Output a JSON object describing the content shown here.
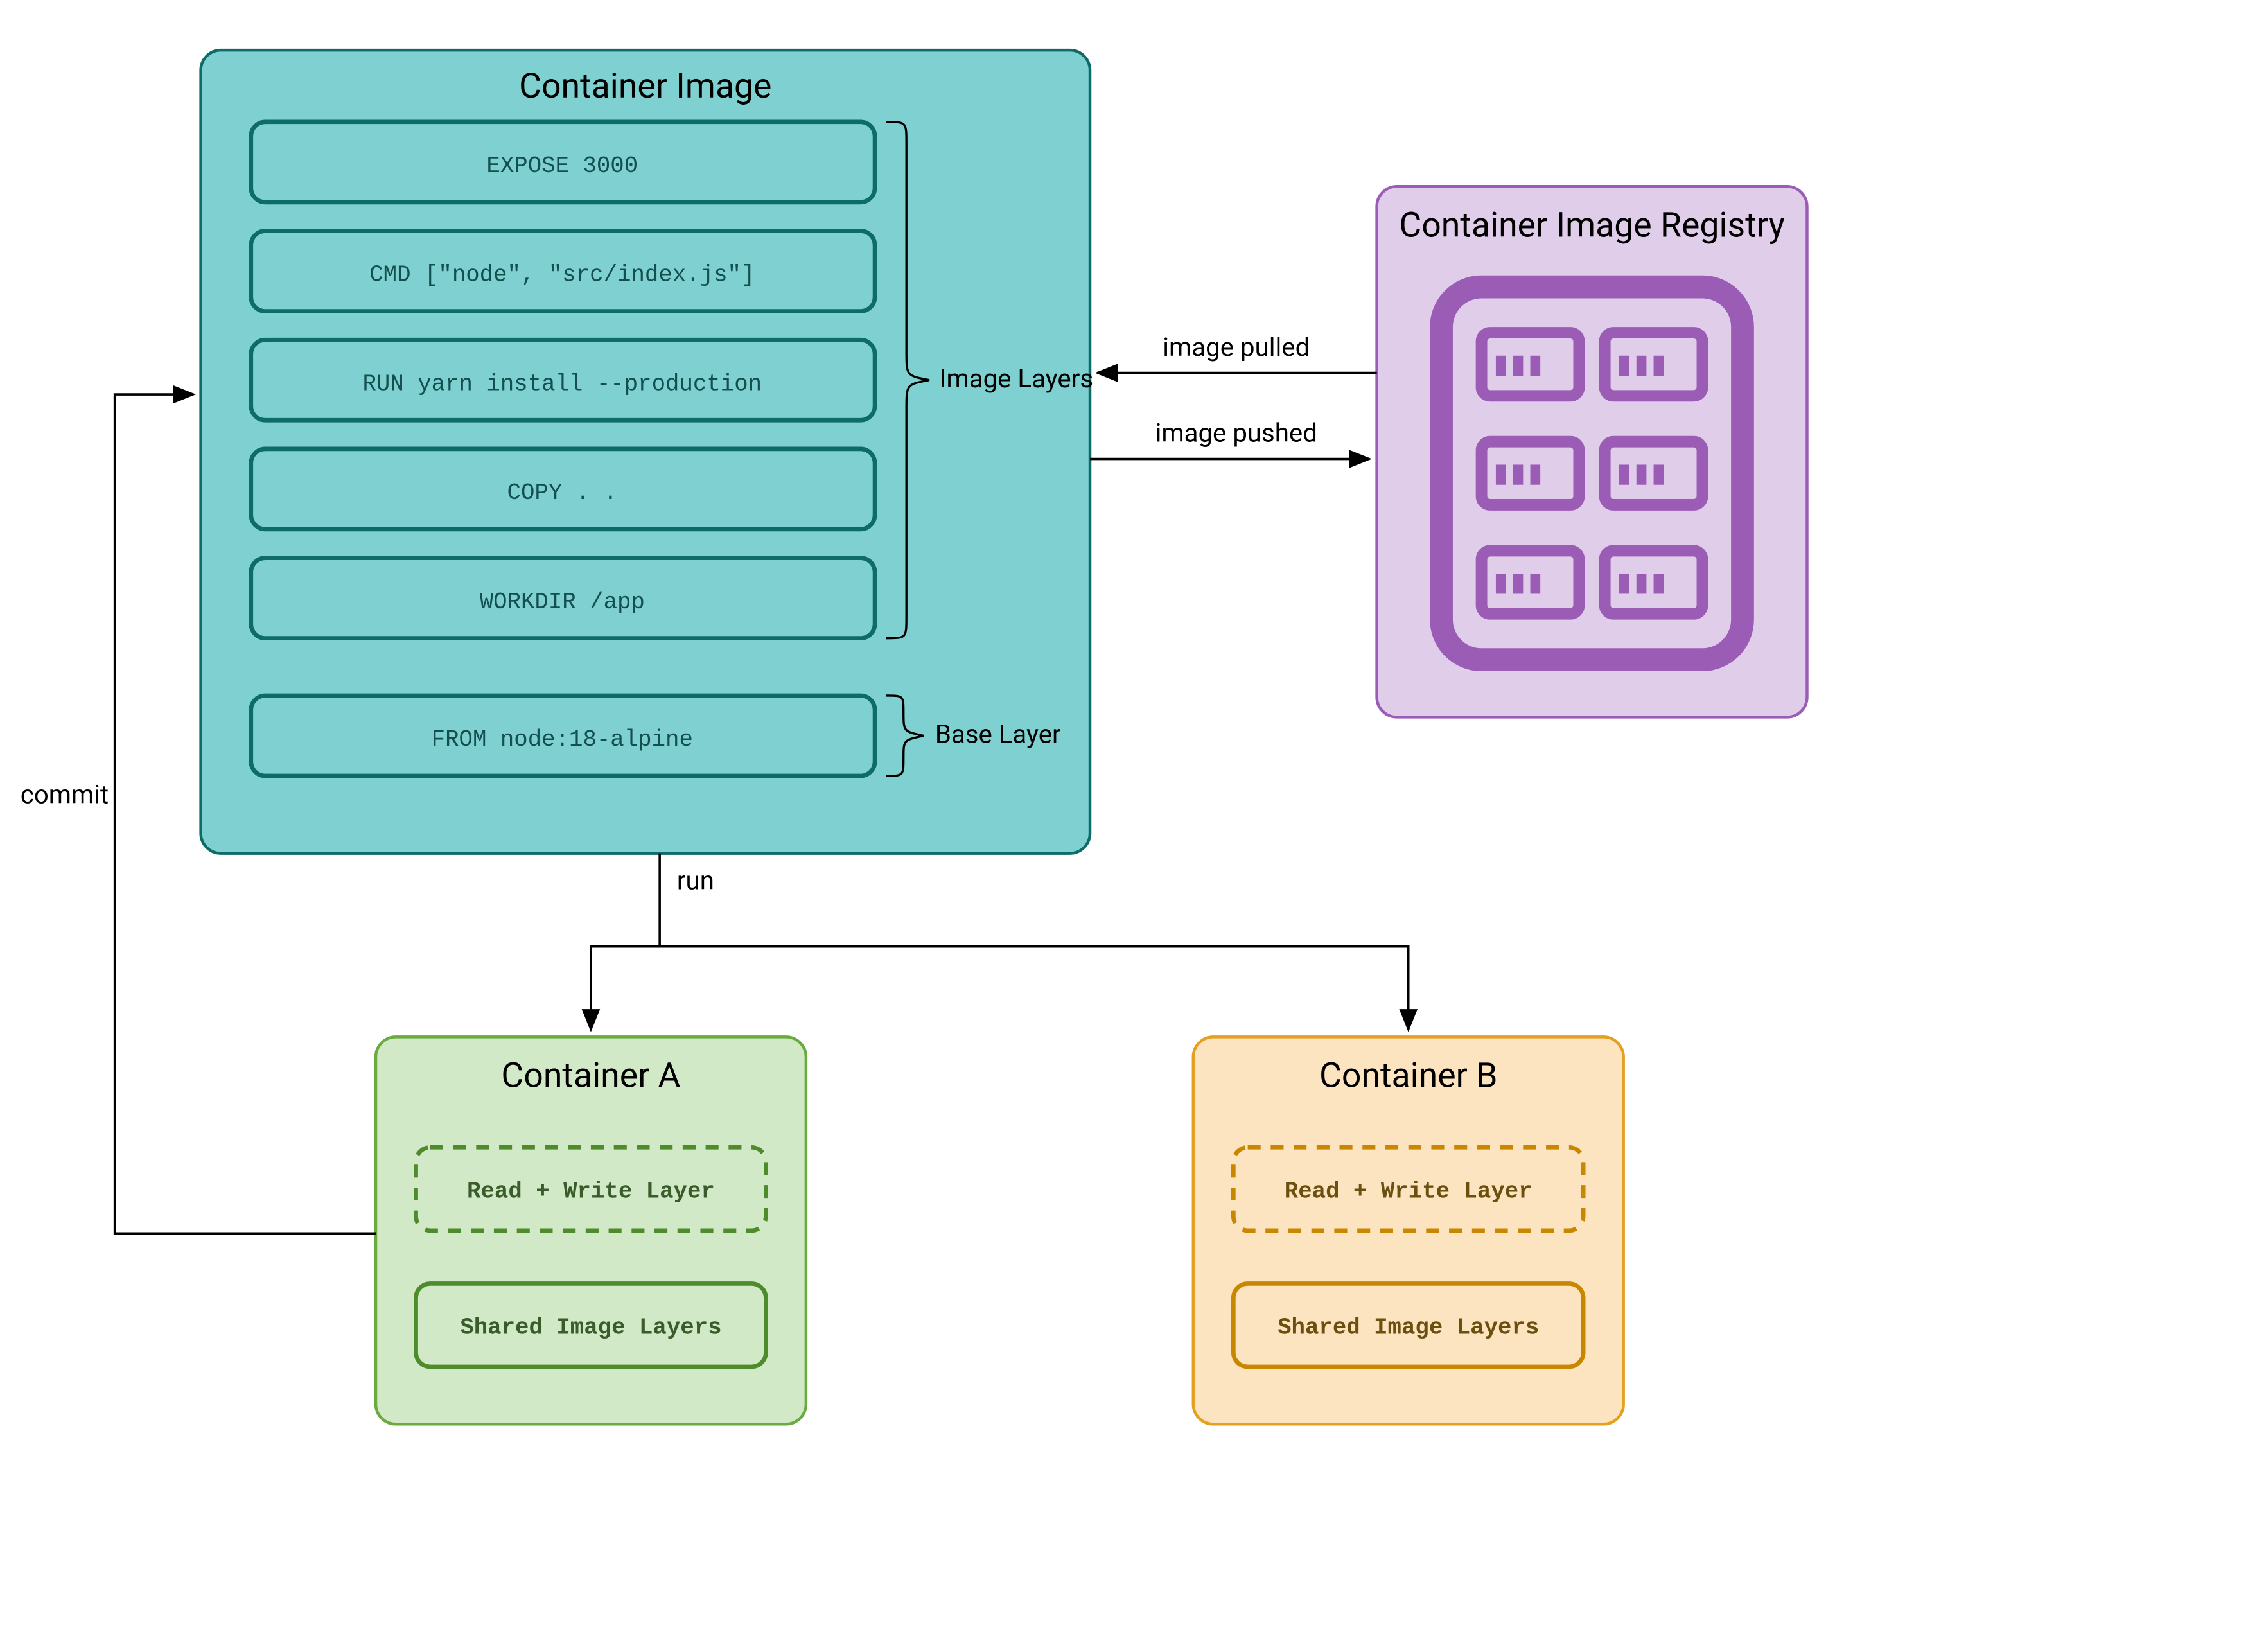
{
  "containerImage": {
    "title": "Container Image",
    "layers": [
      "EXPOSE 3000",
      "CMD [\"node\", \"src/index.js\"]",
      "RUN yarn install --production",
      "COPY . .",
      "WORKDIR /app"
    ],
    "baseLayer": "FROM node:18-alpine",
    "imageLayersLabel": "Image Layers",
    "baseLayerLabel": "Base Layer"
  },
  "registry": {
    "title": "Container Image Registry"
  },
  "arrows": {
    "pull": "image pulled",
    "push": "image pushed",
    "run": "run",
    "commit": "commit"
  },
  "containers": {
    "a": {
      "title": "Container A",
      "rw": "Read + Write Layer",
      "shared": "Shared Image Layers"
    },
    "b": {
      "title": "Container B",
      "rw": "Read + Write Layer",
      "shared": "Shared Image Layers"
    }
  },
  "colors": {
    "teal": "#7fd1d1",
    "tealDark": "#0d6b68",
    "purpleLight": "#e0cdea",
    "purple": "#9b5cb5",
    "greenLight": "#d2e9c8",
    "green": "#6aaa3f",
    "greenDark": "#4e8b2b",
    "orangeLight": "#fde4c0",
    "orange": "#e4a020",
    "orangeDark": "#c98600",
    "black": "#000000"
  }
}
